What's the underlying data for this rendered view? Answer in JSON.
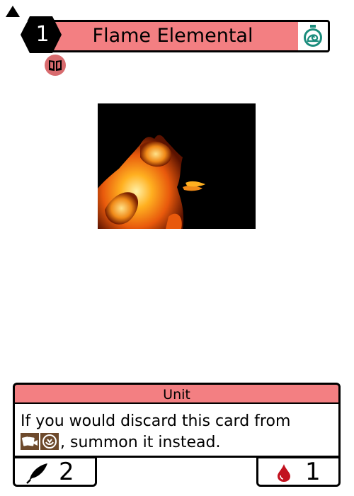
{
  "card": {
    "name": "Flame Elemental",
    "cost": "1",
    "type": "Unit",
    "text_before_icons": "If you would discard this card from",
    "text_after_icons": ", summon it instead.",
    "power": "2",
    "life": "1"
  },
  "icons": {
    "cost_symbol": "bolt-icon",
    "speed_symbol": "slow-timer-icon",
    "set_symbol": "book-icon",
    "hand_symbol": "cards-hand-icon",
    "deck_symbol": "deck-icon",
    "power_symbol": "feather-icon",
    "life_symbol": "blood-drop-icon"
  },
  "colors": {
    "title_bar": "#f37f82",
    "type_bar": "#f37f82",
    "timer": "#1a8c7c",
    "cost_hex": "#000000",
    "blood": "#c2121f",
    "inline_icon_bg": "#6e4a2c"
  }
}
